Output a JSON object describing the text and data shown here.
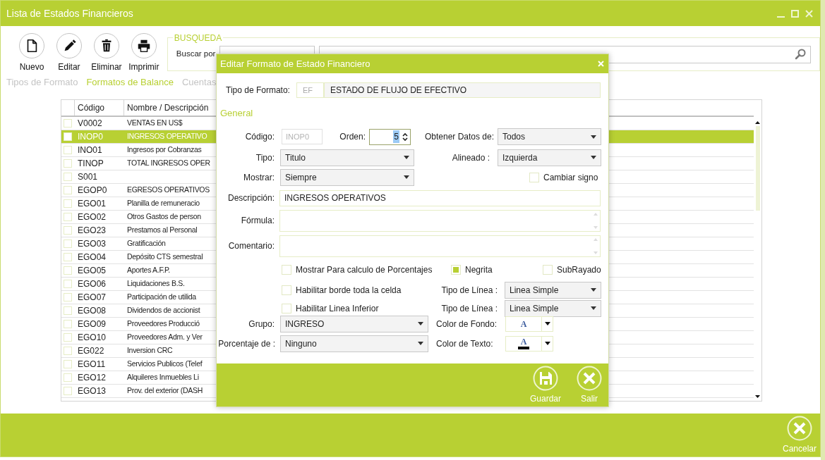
{
  "window": {
    "title": "Lista de Estados Financieros"
  },
  "toolbar": [
    {
      "label": "Nuevo",
      "kind": "new"
    },
    {
      "label": "Editar",
      "kind": "edit"
    },
    {
      "label": "Eliminar",
      "kind": "delete"
    },
    {
      "label": "Imprimir",
      "kind": "print"
    }
  ],
  "search": {
    "legend": "BUSQUEDA",
    "label": "Buscar por"
  },
  "tabs": [
    {
      "label": "Tipos de Formato",
      "selected": false
    },
    {
      "label": "Formatos de Balance",
      "selected": true
    },
    {
      "label": "Cuentas",
      "selected": false
    }
  ],
  "grid": {
    "columns": [
      "Código",
      "Nombre / Descripción"
    ],
    "rows": [
      {
        "code": "V0002",
        "name": "VENTAS EN US$",
        "checked": false,
        "selected": false
      },
      {
        "code": "INOP0",
        "name": "INGRESOS OPERATIVO",
        "checked": false,
        "selected": true
      },
      {
        "code": "INO01",
        "name": "Ingresos por Cobranzas",
        "checked": false,
        "selected": false
      },
      {
        "code": "TINOP",
        "name": "TOTAL INGRESOS OPER",
        "checked": false,
        "selected": false
      },
      {
        "code": "S001",
        "checked": false,
        "selected": false
      },
      {
        "code": "EGOP0",
        "name": "EGRESOS OPERATIVOS",
        "checked": false,
        "selected": false
      },
      {
        "code": "EGO01",
        "name": "Planilla de remuneracio",
        "checked": false,
        "selected": false
      },
      {
        "code": "EGO02",
        "name": "Otros Gastos de person",
        "checked": false,
        "selected": false
      },
      {
        "code": "EGO23",
        "name": "Prestamos al Personal",
        "checked": false,
        "selected": false
      },
      {
        "code": "EGO03",
        "name": "Gratificación",
        "checked": false,
        "selected": false
      },
      {
        "code": "EGO04",
        "name": "Depósito CTS semestral",
        "checked": false,
        "selected": false
      },
      {
        "code": "EGO05",
        "name": "Aportes A.F.P.",
        "checked": false,
        "selected": false
      },
      {
        "code": "EGO06",
        "name": "Liquidaciones B.S.",
        "checked": false,
        "selected": false
      },
      {
        "code": "EGO07",
        "name": "Participación de utilida",
        "checked": false,
        "selected": false
      },
      {
        "code": "EGO08",
        "name": "Dividendos de accionist",
        "checked": false,
        "selected": false
      },
      {
        "code": "EGO09",
        "name": "Proveedores Producció",
        "checked": false,
        "selected": false
      },
      {
        "code": "EGO10",
        "name": "Proveedores Adm. y Ver",
        "checked": false,
        "selected": false
      },
      {
        "code": "EG022",
        "name": "Inversion CRC",
        "checked": false,
        "selected": false
      },
      {
        "code": "EGO11",
        "name": "Servicios Publicos (Telef",
        "checked": false,
        "selected": false
      },
      {
        "code": "EGO12",
        "name": "Alquileres Inmuebles Li",
        "checked": false,
        "selected": false
      },
      {
        "code": "EGO13",
        "name": "Prov. del exterior (DASH",
        "checked": false,
        "selected": false
      }
    ]
  },
  "cancel_button": {
    "label": "Cancelar"
  },
  "dialog": {
    "title": "Editar Formato de Estado Financiero",
    "tipo_formato": {
      "label": "Tipo de Formato:",
      "code": "EF",
      "name": "ESTADO DE FLUJO DE EFECTIVO"
    },
    "section": "General",
    "codigo": {
      "label": "Código:",
      "value": "INOP0",
      "disabled": true
    },
    "orden": {
      "label": "Orden:",
      "value": "5"
    },
    "obtener": {
      "label": "Obtener Datos de:",
      "value": "Todos"
    },
    "tipo": {
      "label": "Tipo:",
      "value": "Titulo"
    },
    "alineado": {
      "label": "Alineado :",
      "value": "Izquierda"
    },
    "mostrar": {
      "label": "Mostrar:",
      "value": "Siempre"
    },
    "cambiar_signo": {
      "label": "Cambiar signo",
      "checked": false
    },
    "descripcion": {
      "label": "Descripción:",
      "value": "INGRESOS OPERATIVOS"
    },
    "formula": {
      "label": "Fórmula:"
    },
    "comentario": {
      "label": "Comentario:"
    },
    "options": [
      {
        "label": "Mostrar Para calculo de Porcentajes",
        "checked": false
      },
      {
        "label": "Negrita",
        "checked": true
      },
      {
        "label": "SubRayado",
        "checked": false
      }
    ],
    "borde": {
      "label": "Habilitar borde toda la celda",
      "checked": false
    },
    "linea_inferior": {
      "label": "Habilitar Linea Inferior",
      "checked": false
    },
    "tipo_linea": [
      {
        "label": "Tipo de Línea :",
        "value": "Linea Simple"
      },
      {
        "label": "Tipo de Línea :",
        "value": "Linea Simple"
      }
    ],
    "grupo": {
      "label": "Grupo:",
      "value": "INGRESO"
    },
    "porcentaje": {
      "label": "Porcentaje de :",
      "value": "Ninguno"
    },
    "color_fondo": {
      "label": "Color de Fondo:",
      "glyph": "A",
      "kind": "fill"
    },
    "color_texto": {
      "label": "Color de Texto:",
      "glyph": "A",
      "kind": "text"
    },
    "buttons": [
      {
        "label": "Guardar",
        "kind": "save"
      },
      {
        "label": "Salir",
        "kind": "exit"
      }
    ]
  }
}
